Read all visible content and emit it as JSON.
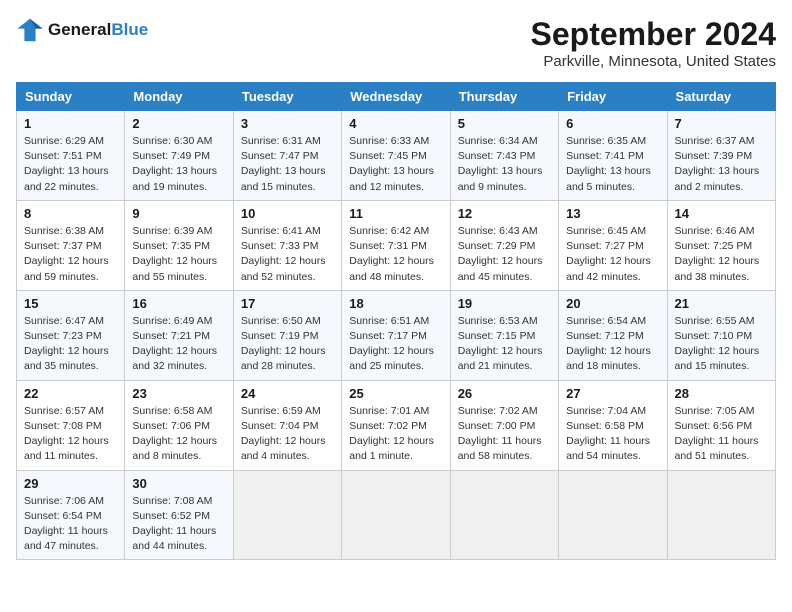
{
  "header": {
    "logo_line1": "General",
    "logo_line2": "Blue",
    "title": "September 2024",
    "subtitle": "Parkville, Minnesota, United States"
  },
  "days_of_week": [
    "Sunday",
    "Monday",
    "Tuesday",
    "Wednesday",
    "Thursday",
    "Friday",
    "Saturday"
  ],
  "weeks": [
    [
      {
        "day": "1",
        "detail": "Sunrise: 6:29 AM\nSunset: 7:51 PM\nDaylight: 13 hours\nand 22 minutes."
      },
      {
        "day": "2",
        "detail": "Sunrise: 6:30 AM\nSunset: 7:49 PM\nDaylight: 13 hours\nand 19 minutes."
      },
      {
        "day": "3",
        "detail": "Sunrise: 6:31 AM\nSunset: 7:47 PM\nDaylight: 13 hours\nand 15 minutes."
      },
      {
        "day": "4",
        "detail": "Sunrise: 6:33 AM\nSunset: 7:45 PM\nDaylight: 13 hours\nand 12 minutes."
      },
      {
        "day": "5",
        "detail": "Sunrise: 6:34 AM\nSunset: 7:43 PM\nDaylight: 13 hours\nand 9 minutes."
      },
      {
        "day": "6",
        "detail": "Sunrise: 6:35 AM\nSunset: 7:41 PM\nDaylight: 13 hours\nand 5 minutes."
      },
      {
        "day": "7",
        "detail": "Sunrise: 6:37 AM\nSunset: 7:39 PM\nDaylight: 13 hours\nand 2 minutes."
      }
    ],
    [
      {
        "day": "8",
        "detail": "Sunrise: 6:38 AM\nSunset: 7:37 PM\nDaylight: 12 hours\nand 59 minutes."
      },
      {
        "day": "9",
        "detail": "Sunrise: 6:39 AM\nSunset: 7:35 PM\nDaylight: 12 hours\nand 55 minutes."
      },
      {
        "day": "10",
        "detail": "Sunrise: 6:41 AM\nSunset: 7:33 PM\nDaylight: 12 hours\nand 52 minutes."
      },
      {
        "day": "11",
        "detail": "Sunrise: 6:42 AM\nSunset: 7:31 PM\nDaylight: 12 hours\nand 48 minutes."
      },
      {
        "day": "12",
        "detail": "Sunrise: 6:43 AM\nSunset: 7:29 PM\nDaylight: 12 hours\nand 45 minutes."
      },
      {
        "day": "13",
        "detail": "Sunrise: 6:45 AM\nSunset: 7:27 PM\nDaylight: 12 hours\nand 42 minutes."
      },
      {
        "day": "14",
        "detail": "Sunrise: 6:46 AM\nSunset: 7:25 PM\nDaylight: 12 hours\nand 38 minutes."
      }
    ],
    [
      {
        "day": "15",
        "detail": "Sunrise: 6:47 AM\nSunset: 7:23 PM\nDaylight: 12 hours\nand 35 minutes."
      },
      {
        "day": "16",
        "detail": "Sunrise: 6:49 AM\nSunset: 7:21 PM\nDaylight: 12 hours\nand 32 minutes."
      },
      {
        "day": "17",
        "detail": "Sunrise: 6:50 AM\nSunset: 7:19 PM\nDaylight: 12 hours\nand 28 minutes."
      },
      {
        "day": "18",
        "detail": "Sunrise: 6:51 AM\nSunset: 7:17 PM\nDaylight: 12 hours\nand 25 minutes."
      },
      {
        "day": "19",
        "detail": "Sunrise: 6:53 AM\nSunset: 7:15 PM\nDaylight: 12 hours\nand 21 minutes."
      },
      {
        "day": "20",
        "detail": "Sunrise: 6:54 AM\nSunset: 7:12 PM\nDaylight: 12 hours\nand 18 minutes."
      },
      {
        "day": "21",
        "detail": "Sunrise: 6:55 AM\nSunset: 7:10 PM\nDaylight: 12 hours\nand 15 minutes."
      }
    ],
    [
      {
        "day": "22",
        "detail": "Sunrise: 6:57 AM\nSunset: 7:08 PM\nDaylight: 12 hours\nand 11 minutes."
      },
      {
        "day": "23",
        "detail": "Sunrise: 6:58 AM\nSunset: 7:06 PM\nDaylight: 12 hours\nand 8 minutes."
      },
      {
        "day": "24",
        "detail": "Sunrise: 6:59 AM\nSunset: 7:04 PM\nDaylight: 12 hours\nand 4 minutes."
      },
      {
        "day": "25",
        "detail": "Sunrise: 7:01 AM\nSunset: 7:02 PM\nDaylight: 12 hours\nand 1 minute."
      },
      {
        "day": "26",
        "detail": "Sunrise: 7:02 AM\nSunset: 7:00 PM\nDaylight: 11 hours\nand 58 minutes."
      },
      {
        "day": "27",
        "detail": "Sunrise: 7:04 AM\nSunset: 6:58 PM\nDaylight: 11 hours\nand 54 minutes."
      },
      {
        "day": "28",
        "detail": "Sunrise: 7:05 AM\nSunset: 6:56 PM\nDaylight: 11 hours\nand 51 minutes."
      }
    ],
    [
      {
        "day": "29",
        "detail": "Sunrise: 7:06 AM\nSunset: 6:54 PM\nDaylight: 11 hours\nand 47 minutes."
      },
      {
        "day": "30",
        "detail": "Sunrise: 7:08 AM\nSunset: 6:52 PM\nDaylight: 11 hours\nand 44 minutes."
      },
      {
        "day": "",
        "detail": ""
      },
      {
        "day": "",
        "detail": ""
      },
      {
        "day": "",
        "detail": ""
      },
      {
        "day": "",
        "detail": ""
      },
      {
        "day": "",
        "detail": ""
      }
    ]
  ]
}
